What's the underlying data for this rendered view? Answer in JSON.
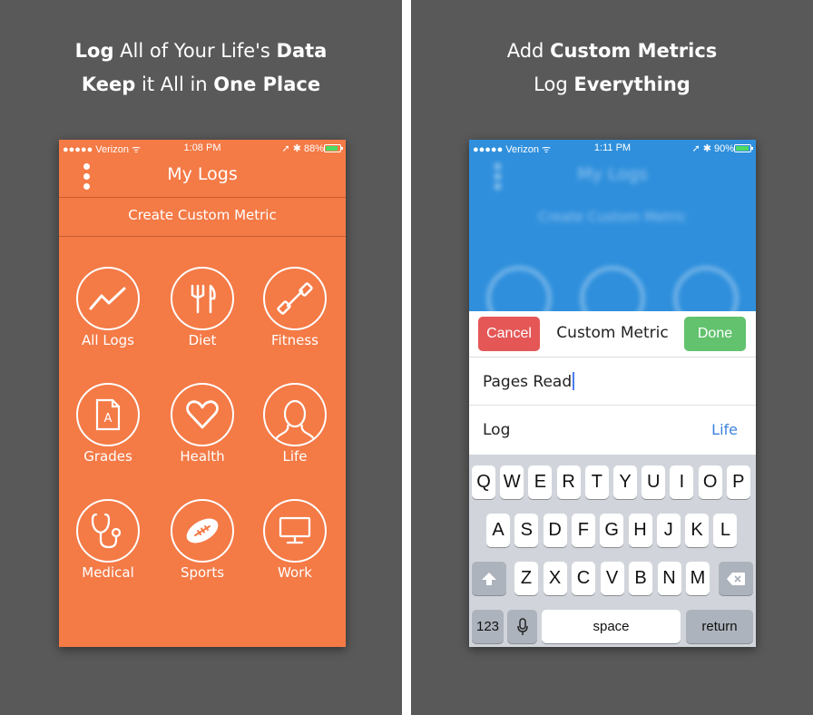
{
  "left_panel": {
    "caption_line1": [
      {
        "text": "Log",
        "bold": true
      },
      {
        "text": " All of Your Life's ",
        "bold": false
      },
      {
        "text": "Data",
        "bold": true
      }
    ],
    "caption_line2": [
      {
        "text": "Keep",
        "bold": true
      },
      {
        "text": " it All in ",
        "bold": false
      },
      {
        "text": "One Place",
        "bold": true
      }
    ],
    "status": {
      "carrier": "●●●●● Verizon ᯤ",
      "time": "1:08 PM",
      "right": "➚ ✱ 88%"
    },
    "nav_title": "My Logs",
    "create_metric": "Create Custom Metric",
    "categories": [
      {
        "label": "All Logs",
        "icon": "chart-line-icon"
      },
      {
        "label": "Diet",
        "icon": "fork-knife-icon"
      },
      {
        "label": "Fitness",
        "icon": "dumbbell-icon"
      },
      {
        "label": "Grades",
        "icon": "document-grade-icon"
      },
      {
        "label": "Health",
        "icon": "heart-icon"
      },
      {
        "label": "Life",
        "icon": "person-silhouette-icon"
      },
      {
        "label": "Medical",
        "icon": "stethoscope-icon"
      },
      {
        "label": "Sports",
        "icon": "football-icon"
      },
      {
        "label": "Work",
        "icon": "monitor-icon"
      }
    ],
    "battery_level": 0.88,
    "colors": {
      "accent": "#f47a46",
      "background": "#595959"
    }
  },
  "right_panel": {
    "caption_line1": [
      {
        "text": "Add ",
        "bold": false
      },
      {
        "text": "Custom Metrics",
        "bold": true
      }
    ],
    "caption_line2": [
      {
        "text": "Log ",
        "bold": false
      },
      {
        "text": "Everything",
        "bold": true
      }
    ],
    "status": {
      "carrier": "●●●●● Verizon ᯤ",
      "time": "1:11 PM",
      "right": "➚ ✱ 90%"
    },
    "blurred_title": "My Logs",
    "blurred_create": "Create Custom Metric",
    "cancel_label": "Cancel",
    "done_label": "Done",
    "metric_title": "Custom Metric",
    "metric_name_value": "Pages Read",
    "log_label": "Log",
    "log_value": "Life",
    "battery_level": 0.9,
    "keyboard": {
      "row1": [
        "Q",
        "W",
        "E",
        "R",
        "T",
        "Y",
        "U",
        "I",
        "O",
        "P"
      ],
      "row2": [
        "A",
        "S",
        "D",
        "F",
        "G",
        "H",
        "J",
        "K",
        "L"
      ],
      "row3": [
        "Z",
        "X",
        "C",
        "V",
        "B",
        "N",
        "M"
      ],
      "numbers_label": "123",
      "space_label": "space",
      "return_label": "return"
    },
    "colors": {
      "blue": "#2f8fdc",
      "cancel": "#e55757",
      "done": "#62c26e"
    }
  }
}
